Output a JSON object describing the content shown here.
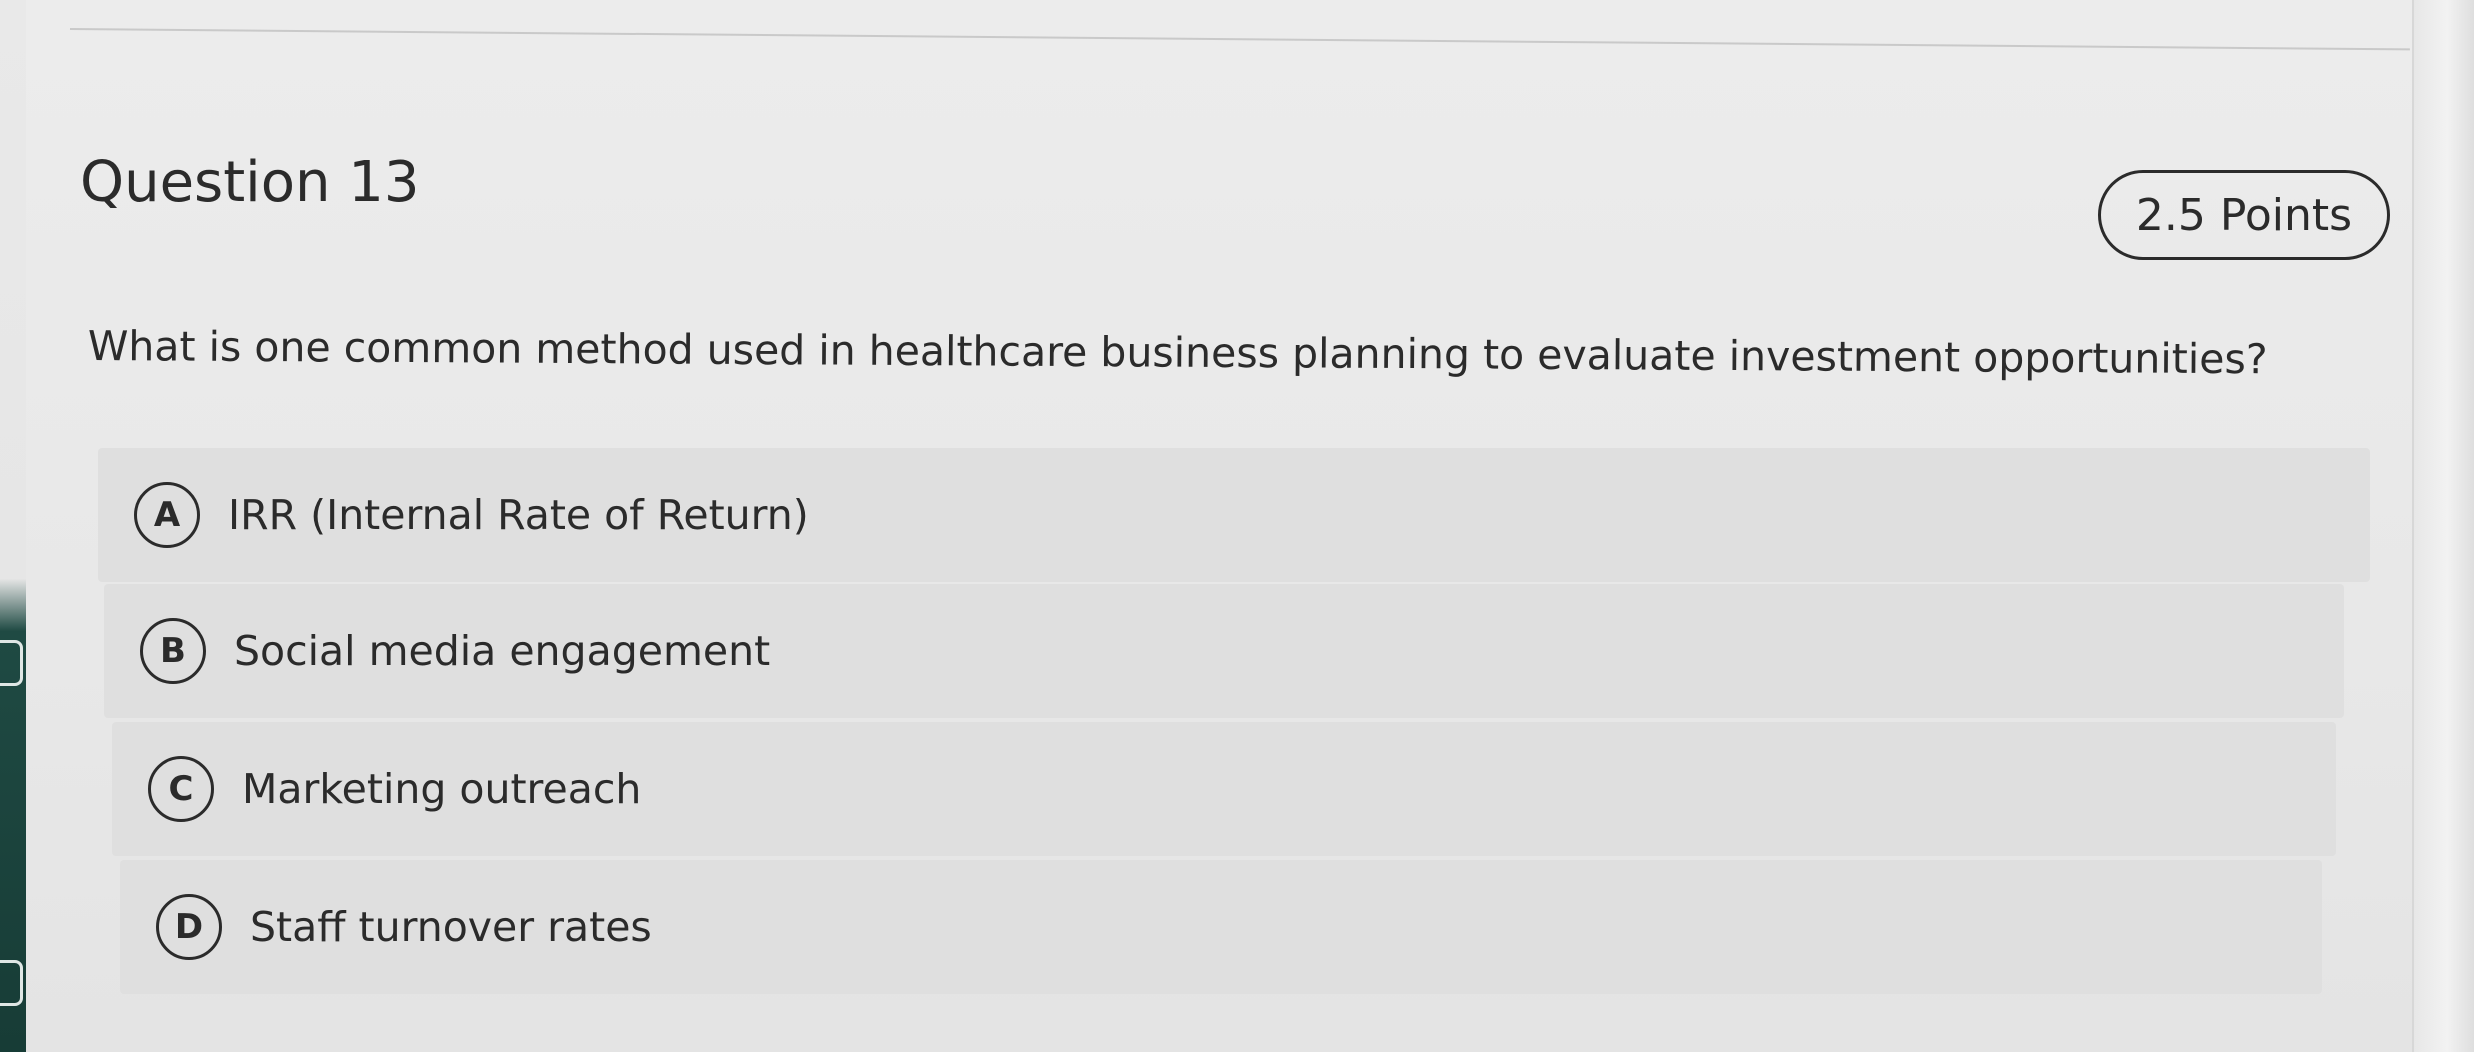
{
  "question": {
    "title": "Question 13",
    "points": "2.5 Points",
    "prompt": "What is one common method used in healthcare business planning to evaluate investment opportunities?"
  },
  "options": [
    {
      "letter": "A",
      "text": "IRR (Internal Rate of Return)"
    },
    {
      "letter": "B",
      "text": "Social media engagement"
    },
    {
      "letter": "C",
      "text": "Marketing outreach"
    },
    {
      "letter": "D",
      "text": "Staff turnover rates"
    }
  ],
  "colors": {
    "text": "#2b2b2b",
    "option_background": "#dfdfdf",
    "page_background": "#ececec"
  }
}
